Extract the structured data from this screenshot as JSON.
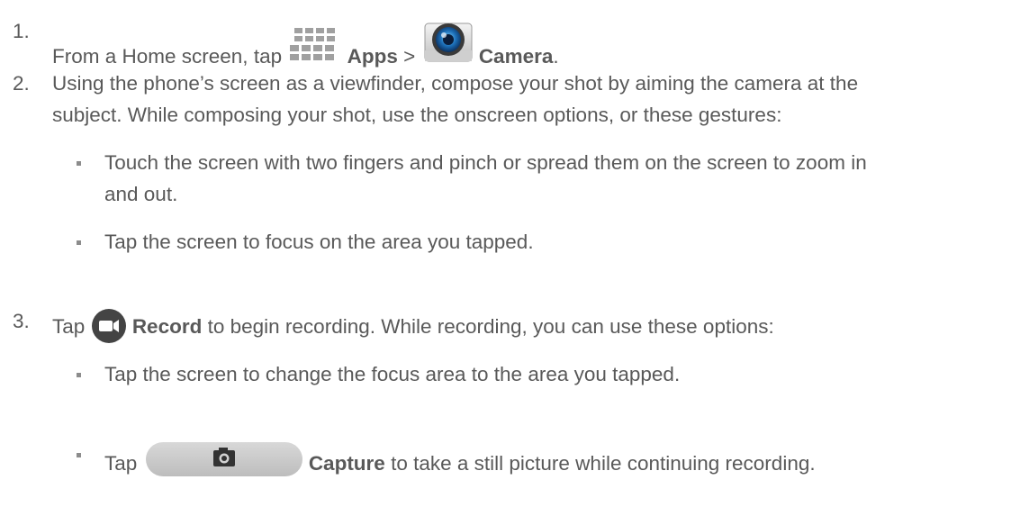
{
  "steps": [
    {
      "number": "1.",
      "before": "From a Home screen, tap",
      "apps_label": "Apps",
      "sep": ">",
      "camera_label": "Camera",
      "period": "."
    },
    {
      "number": "2.",
      "line1": "Using the phone’s screen as a viewfinder, compose your shot by aiming the camera at the",
      "line2": "subject. While composing your shot, use the onscreen options, or these gestures:",
      "bullets": [
        {
          "line1": "Touch the screen with two fingers and pinch or spread them on the screen to zoom in",
          "line2": "and out."
        },
        {
          "line1": "Tap the screen to focus on the area you tapped."
        }
      ]
    },
    {
      "number": "3.",
      "before": "Tap",
      "record_label": "Record",
      "after": "to begin recording. While recording, you can use these options:",
      "bullets": [
        {
          "line1": "Tap the screen to change the focus area to the area you tapped."
        },
        {
          "before": "Tap",
          "capture_label": "Capture",
          "after": "to take a still picture while continuing recording."
        }
      ]
    }
  ],
  "icons": {
    "apps": "apps-grid-icon",
    "camera": "camera-app-icon",
    "record": "video-record-icon",
    "capture": "capture-camera-icon"
  }
}
